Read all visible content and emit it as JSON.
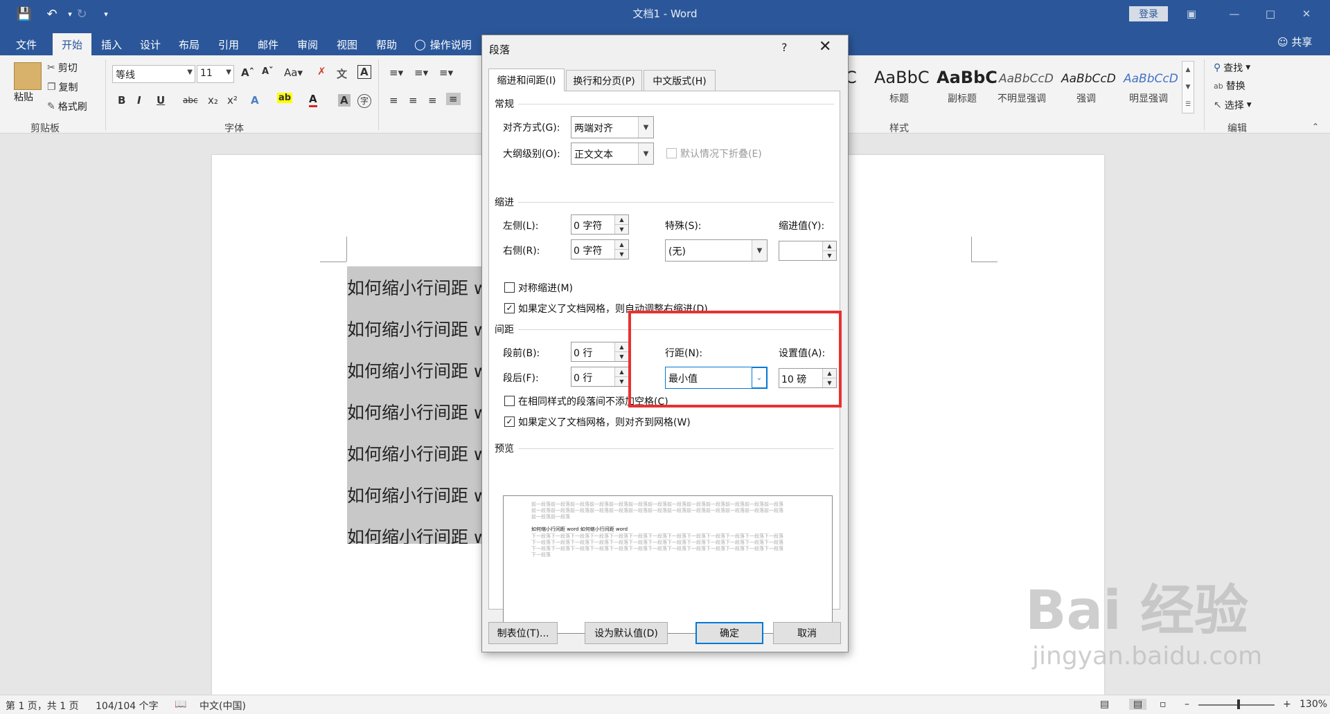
{
  "titlebar": {
    "doc_title": "文档1  -  Word",
    "login": "登录"
  },
  "tabs": [
    "文件",
    "开始",
    "插入",
    "设计",
    "布局",
    "引用",
    "邮件",
    "审阅",
    "视图",
    "帮助",
    "操作说明"
  ],
  "share": "共享",
  "ribbon": {
    "clipboard": {
      "paste": "粘贴",
      "cut": "剪切",
      "copy": "复制",
      "format_painter": "格式刷",
      "label": "剪贴板"
    },
    "font": {
      "name": "等线",
      "size": "11",
      "label": "字体"
    },
    "styles": {
      "items": [
        {
          "sample": "AaBbC",
          "name": "标题"
        },
        {
          "sample": "AaBbC",
          "name": "副标题"
        },
        {
          "sample": "AaBbCcD",
          "name": "不明显强调"
        },
        {
          "sample": "AaBbCcD",
          "name": "强调"
        },
        {
          "sample": "AaBbCcD",
          "name": "明显强调"
        }
      ],
      "label": "样式"
    },
    "editing": {
      "find": "查找",
      "replace": "替换",
      "select": "选择",
      "label": "编辑"
    }
  },
  "document": {
    "lines": [
      "如何缩小行间距 word",
      "如何缩小行间距 word",
      "如何缩小行间距 word",
      "如何缩小行间距 word",
      "如何缩小行间距 word",
      "如何缩小行间距 word",
      "如何缩小行间距 word"
    ]
  },
  "status": {
    "page": "第 1 页，共 1 页",
    "words": "104/104 个字",
    "lang": "中文(中国)",
    "zoom": "130%"
  },
  "dialog": {
    "title": "段落",
    "help": "?",
    "tabs": [
      "缩进和间距(I)",
      "换行和分页(P)",
      "中文版式(H)"
    ],
    "general": {
      "title": "常规",
      "alignment_label": "对齐方式(G):",
      "alignment_value": "两端对齐",
      "outline_label": "大纲级别(O):",
      "outline_value": "正文文本",
      "collapse_label": "默认情况下折叠(E)"
    },
    "indent": {
      "title": "缩进",
      "left_label": "左侧(L):",
      "left_value": "0 字符",
      "right_label": "右侧(R):",
      "right_value": "0 字符",
      "special_label": "特殊(S):",
      "special_value": "(无)",
      "by_label": "缩进值(Y):",
      "by_value": "",
      "mirror_label": "对称缩进(M)",
      "auto_adjust_label": "如果定义了文档网格，则自动调整右缩进(D)"
    },
    "spacing": {
      "title": "间距",
      "before_label": "段前(B):",
      "before_value": "0 行",
      "after_label": "段后(F):",
      "after_value": "0 行",
      "line_label": "行距(N):",
      "line_value": "最小值",
      "at_label": "设置值(A):",
      "at_value": "10 磅",
      "no_space_label": "在相同样式的段落间不添加空格(C)",
      "snap_label": "如果定义了文档网格，则对齐到网格(W)"
    },
    "preview": {
      "title": "预览",
      "prev": "前一段落前一段落前一段落前一段落前一段落前一段落前一段落前一段落前一段落前一段落前一段落前一段落前一段落前一段落前一段落前一段落前一段落前一段落前一段落前一段落前一段落前一段落前一段落前一段落前一段落前一段落前一段落前一段落",
      "current": "如何缩小行间距 word 如何缩小行间距 word",
      "next": "下一段落下一段落下一段落下一段落下一段落下一段落下一段落下一段落下一段落下一段落下一段落下一段落下一段落下一段落下一段落下一段落下一段落下一段落下一段落下一段落下一段落下一段落下一段落下一段落下一段落下一段落下一段落下一段落下一段落下一段落下一段落下一段落下一段落下一段落下一段落下一段落下一段落下一段落下一段落下一段落"
    },
    "buttons": {
      "tabs": "制表位(T)...",
      "default": "设为默认值(D)",
      "ok": "确定",
      "cancel": "取消"
    }
  },
  "watermark": {
    "main": "Bai 经验",
    "sub": "jingyan.baidu.com"
  }
}
